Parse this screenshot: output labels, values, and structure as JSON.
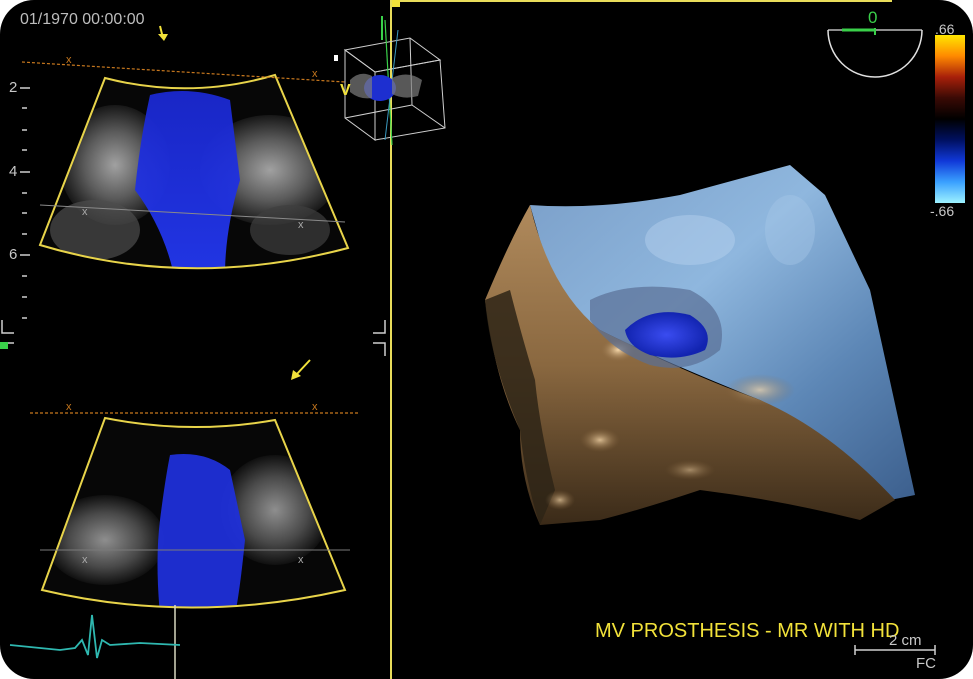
{
  "header": {
    "timestamp": "01/1970 00:00:00"
  },
  "depth_scale": {
    "labels": [
      "2",
      "4",
      "6"
    ]
  },
  "orientation_dial": {
    "angle": "0"
  },
  "color_scale": {
    "top_value": ".66",
    "bottom_value": "-.66",
    "colors": [
      "#ffe600",
      "#ff8a00",
      "#a8200a",
      "#3a0a05",
      "#000000",
      "#001060",
      "#1038d8",
      "#3aa0ff",
      "#9df2ff"
    ]
  },
  "annotation": {
    "title": "MV PROSTHESIS - MR WITH HD"
  },
  "scale_bar": {
    "label": "2 cm"
  },
  "footer": {
    "corner_text": "FC"
  },
  "cube_marker": {
    "label": "V"
  },
  "icons": [
    "arrow-down-icon",
    "arrow-down-left-icon",
    "orientation-cube-icon",
    "orientation-dial-icon",
    "ecg-trace-icon"
  ]
}
